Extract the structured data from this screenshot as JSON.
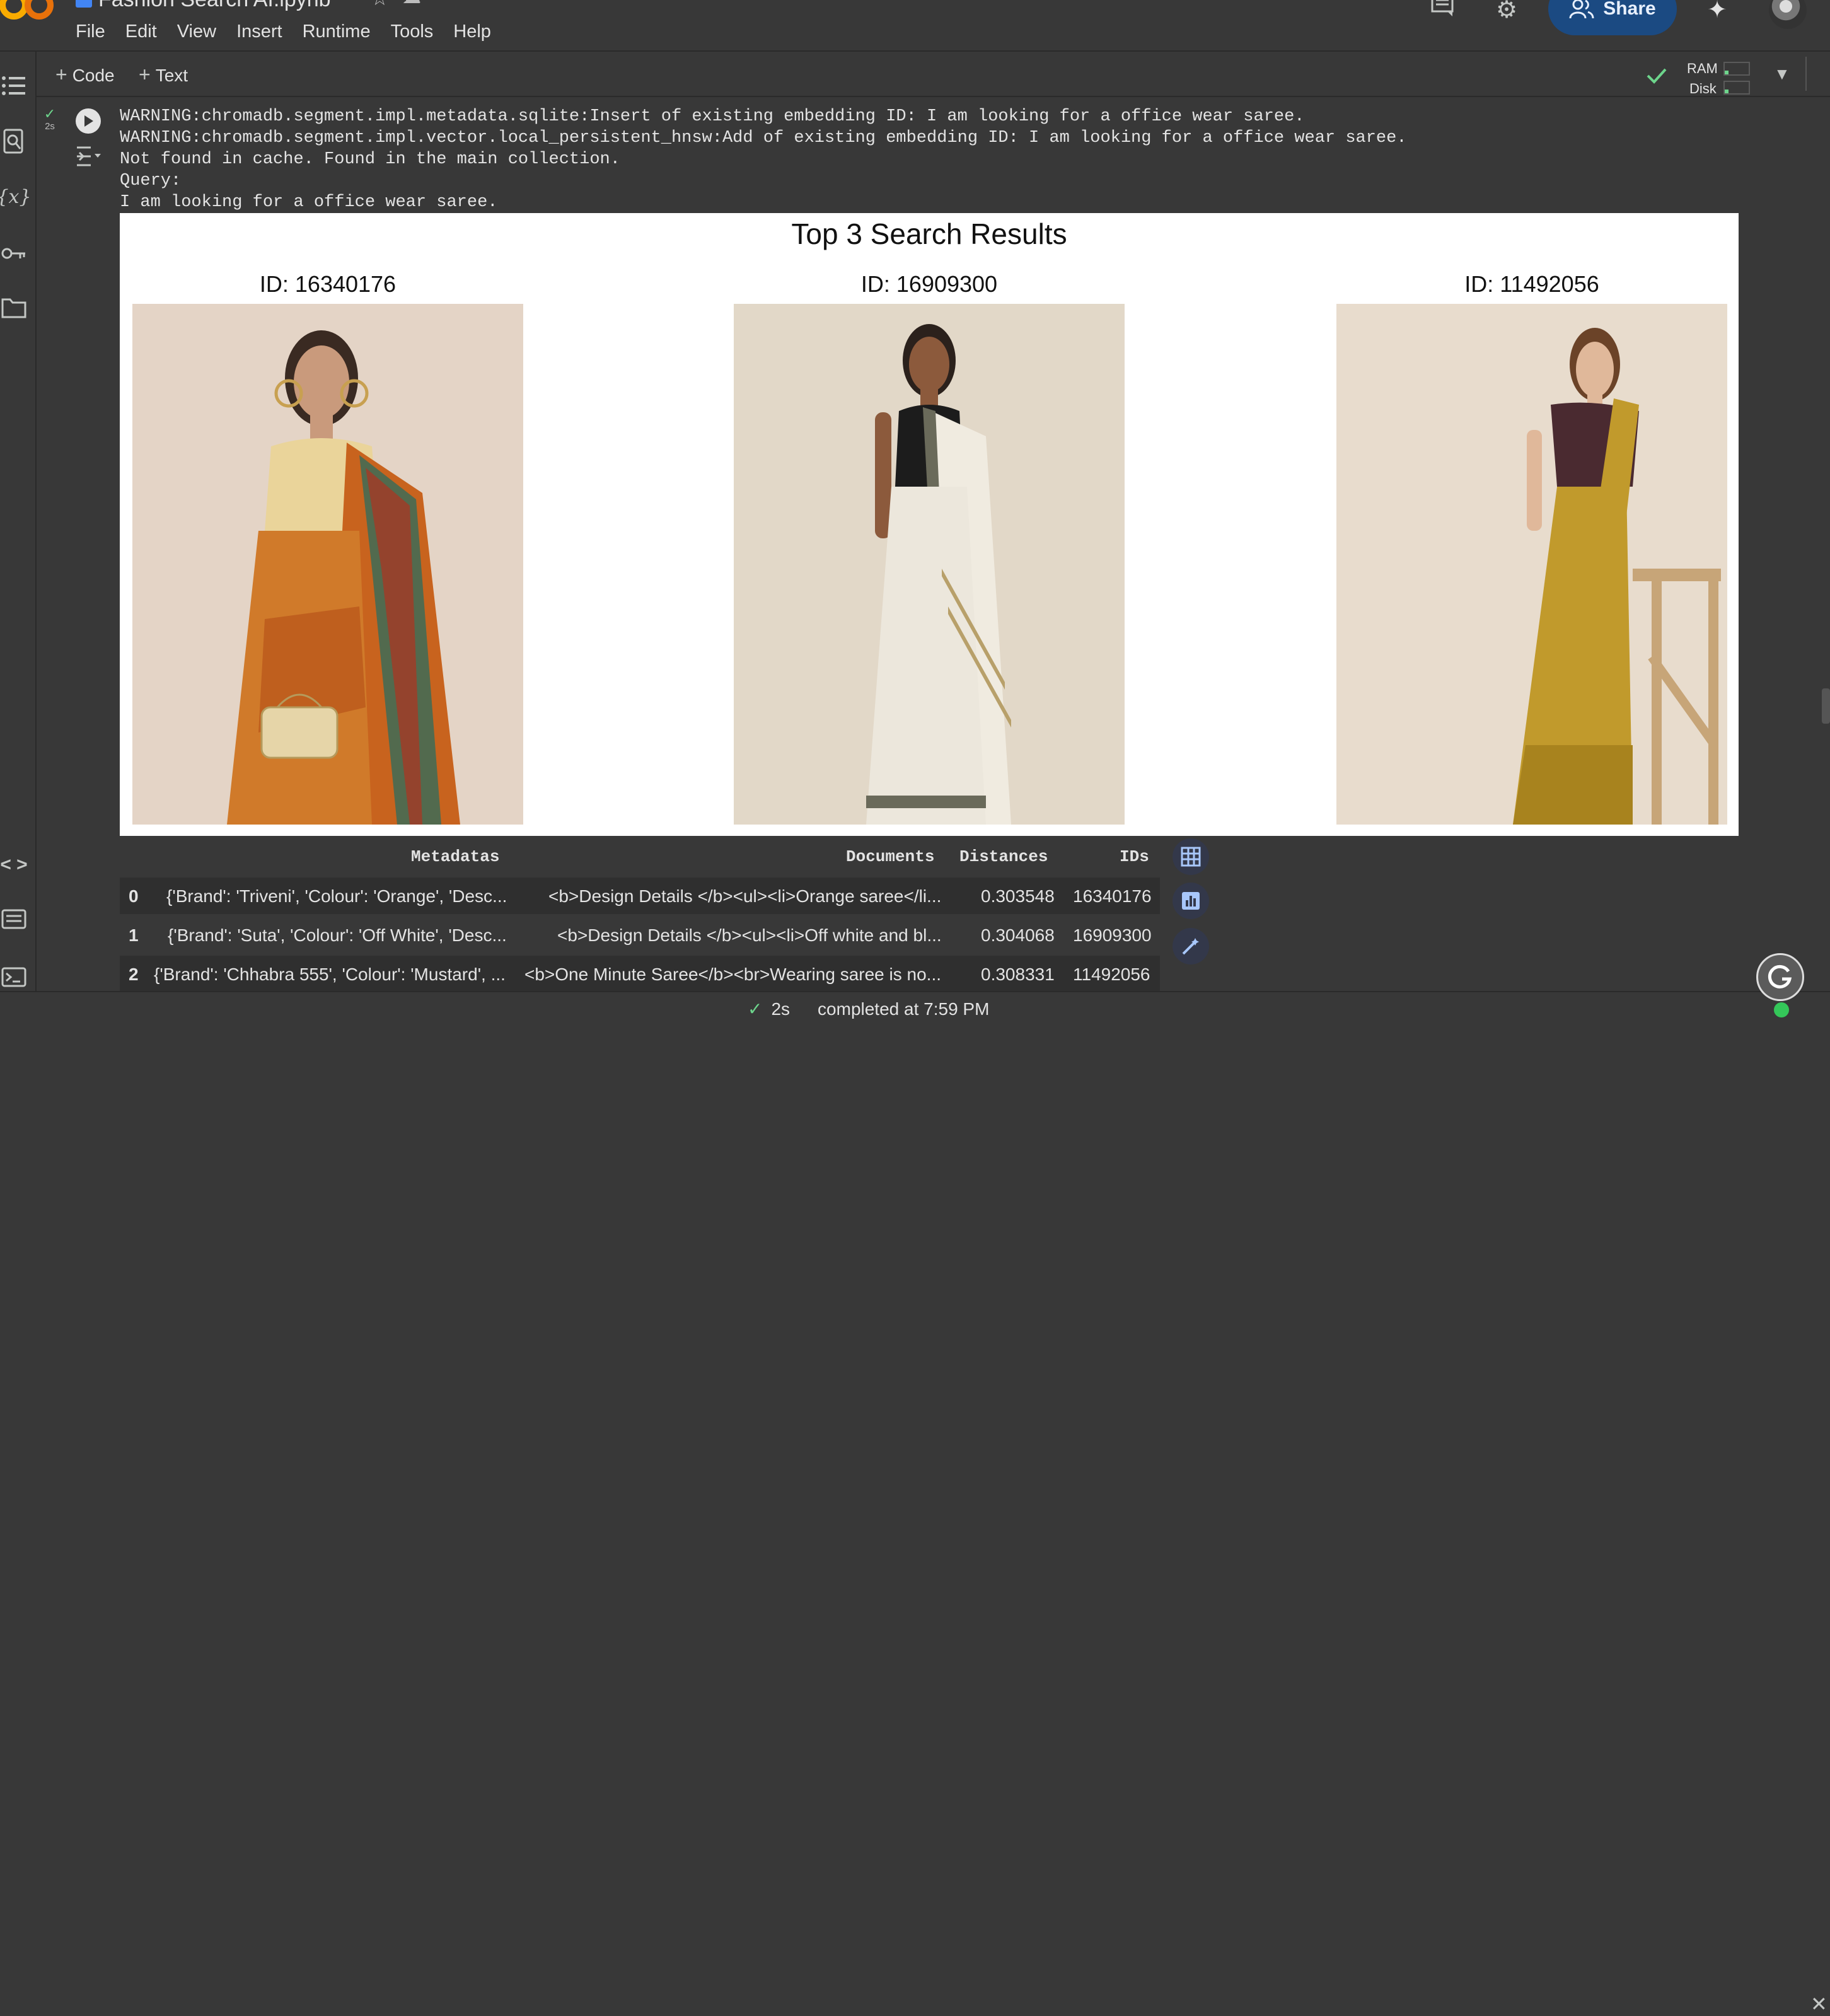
{
  "app": {
    "title": "Fashion Search AI.ipynb",
    "menu": [
      "File",
      "Edit",
      "View",
      "Insert",
      "Runtime",
      "Tools",
      "Help"
    ],
    "share_label": "Share"
  },
  "toolbar": {
    "add_code": "Code",
    "add_text": "Text",
    "ram_label": "RAM",
    "disk_label": "Disk",
    "ram_usage": 0.15,
    "disk_usage": 0.15
  },
  "cell": {
    "exec_time": "2s",
    "output_lines": [
      "WARNING:chromadb.segment.impl.metadata.sqlite:Insert of existing embedding ID: I am looking for a office wear saree.",
      "WARNING:chromadb.segment.impl.vector.local_persistent_hnsw:Add of existing embedding ID: I am looking for a office wear saree.",
      "Not found in cache. Found in the main collection.",
      "Query:",
      "I am looking for a office wear saree."
    ]
  },
  "figure": {
    "title": "Top 3 Search Results",
    "results": [
      {
        "id_label": "ID: 16340176"
      },
      {
        "id_label": "ID: 16909300"
      },
      {
        "id_label": "ID: 11492056"
      }
    ]
  },
  "dataframe": {
    "columns": [
      "Metadatas",
      "Documents",
      "Distances",
      "IDs"
    ],
    "rows": [
      {
        "index": "0",
        "metadatas": "{'Brand': 'Triveni', 'Colour': 'Orange', 'Desc...",
        "documents": "<b>Design Details </b><ul><li>Orange saree</li...",
        "distances": "0.303548",
        "ids": "16340176"
      },
      {
        "index": "1",
        "metadatas": "{'Brand': 'Suta', 'Colour': 'Off White', 'Desc...",
        "documents": "<b>Design Details </b><ul><li>Off white and bl...",
        "distances": "0.304068",
        "ids": "16909300"
      },
      {
        "index": "2",
        "metadatas": "{'Brand': 'Chhabra 555', 'Colour': 'Mustard', ...",
        "documents": "<b>One Minute Saree</b><br>Wearing saree is no...",
        "distances": "0.308331",
        "ids": "11492056"
      }
    ]
  },
  "status": {
    "time": "2s",
    "text": "completed at 7:59 PM"
  },
  "colors": {
    "accent_green": "#6dd58c",
    "share_bg": "#1b4a82",
    "saree_orange": "#c8631e",
    "saree_white": "#ece7dc",
    "saree_mustard": "#c19a2c",
    "backdrop": "#e6d8c8"
  }
}
